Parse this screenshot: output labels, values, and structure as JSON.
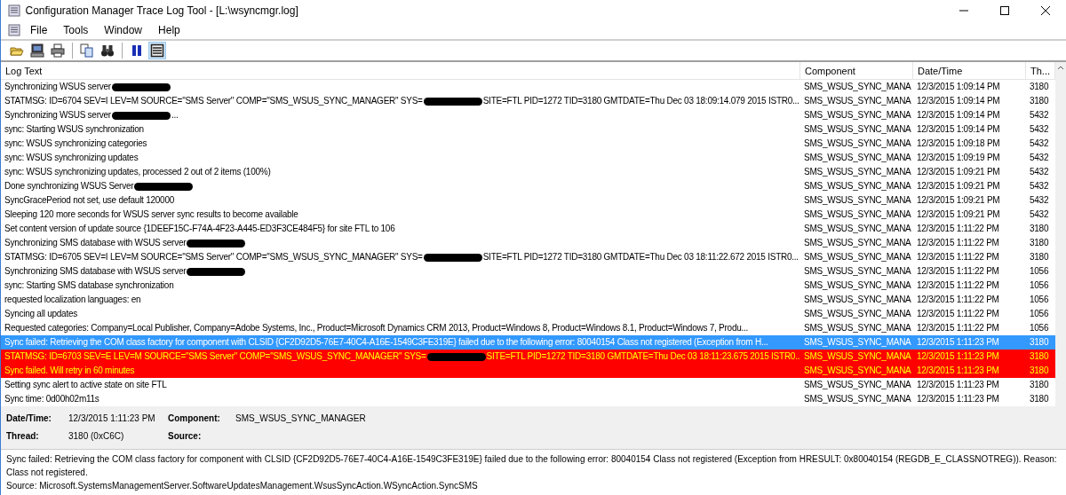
{
  "window": {
    "title": "Configuration Manager Trace Log Tool - [L:\\wsyncmgr.log]"
  },
  "menu": [
    "File",
    "Tools",
    "Window",
    "Help"
  ],
  "toolbar": [
    {
      "kind": "open",
      "pressed": false
    },
    {
      "kind": "computer",
      "pressed": false
    },
    {
      "kind": "print",
      "pressed": false
    },
    {
      "kind": "separator"
    },
    {
      "kind": "copy",
      "pressed": false
    },
    {
      "kind": "find",
      "pressed": false
    },
    {
      "kind": "separator"
    },
    {
      "kind": "pause",
      "pressed": false
    },
    {
      "kind": "highlight",
      "pressed": true
    }
  ],
  "table": {
    "columns": [
      "Log Text",
      "Component",
      "Date/Time",
      "Th..."
    ],
    "rows": [
      {
        "segments": [
          {
            "kind": "text",
            "text": "Synchronizing WSUS server"
          },
          {
            "kind": "redaction"
          }
        ],
        "component": "SMS_WSUS_SYNC_MANA",
        "datetime": "12/3/2015 1:09:14 PM",
        "thread": "3180",
        "selected": false,
        "error": false
      },
      {
        "segments": [
          {
            "kind": "text",
            "text": "STATMSG: ID=6704 SEV=I LEV=M SOURCE=\"SMS Server\" COMP=\"SMS_WSUS_SYNC_MANAGER\" SYS="
          },
          {
            "kind": "redaction"
          },
          {
            "kind": "text",
            "text": "SITE=FTL PID=1272 TID=3180 GMTDATE=Thu Dec 03 18:09:14.079 2015 ISTR0..."
          }
        ],
        "component": "SMS_WSUS_SYNC_MANA",
        "datetime": "12/3/2015 1:09:14 PM",
        "thread": "3180",
        "selected": false,
        "error": false
      },
      {
        "segments": [
          {
            "kind": "text",
            "text": "Synchronizing WSUS server"
          },
          {
            "kind": "redaction"
          },
          {
            "kind": "text",
            "text": "..."
          }
        ],
        "component": "SMS_WSUS_SYNC_MANA",
        "datetime": "12/3/2015 1:09:14 PM",
        "thread": "5432",
        "selected": false,
        "error": false
      },
      {
        "segments": [
          {
            "kind": "text",
            "text": "sync: Starting WSUS synchronization"
          }
        ],
        "component": "SMS_WSUS_SYNC_MANA",
        "datetime": "12/3/2015 1:09:14 PM",
        "thread": "5432",
        "selected": false,
        "error": false
      },
      {
        "segments": [
          {
            "kind": "text",
            "text": "sync: WSUS synchronizing categories"
          }
        ],
        "component": "SMS_WSUS_SYNC_MANA",
        "datetime": "12/3/2015 1:09:18 PM",
        "thread": "5432",
        "selected": false,
        "error": false
      },
      {
        "segments": [
          {
            "kind": "text",
            "text": "sync: WSUS synchronizing updates"
          }
        ],
        "component": "SMS_WSUS_SYNC_MANA",
        "datetime": "12/3/2015 1:09:19 PM",
        "thread": "5432",
        "selected": false,
        "error": false
      },
      {
        "segments": [
          {
            "kind": "text",
            "text": "sync: WSUS synchronizing updates, processed 2 out of 2 items (100%)"
          }
        ],
        "component": "SMS_WSUS_SYNC_MANA",
        "datetime": "12/3/2015 1:09:21 PM",
        "thread": "5432",
        "selected": false,
        "error": false
      },
      {
        "segments": [
          {
            "kind": "text",
            "text": "Done synchronizing WSUS Server"
          },
          {
            "kind": "redaction"
          }
        ],
        "component": "SMS_WSUS_SYNC_MANA",
        "datetime": "12/3/2015 1:09:21 PM",
        "thread": "5432",
        "selected": false,
        "error": false
      },
      {
        "segments": [
          {
            "kind": "text",
            "text": "SyncGracePeriod not set, use default 120000"
          }
        ],
        "component": "SMS_WSUS_SYNC_MANA",
        "datetime": "12/3/2015 1:09:21 PM",
        "thread": "5432",
        "selected": false,
        "error": false
      },
      {
        "segments": [
          {
            "kind": "text",
            "text": "Sleeping 120 more seconds for WSUS server sync results to become available"
          }
        ],
        "component": "SMS_WSUS_SYNC_MANA",
        "datetime": "12/3/2015 1:09:21 PM",
        "thread": "5432",
        "selected": false,
        "error": false
      },
      {
        "segments": [
          {
            "kind": "text",
            "text": "Set content version of update source {1DEEF15C-F74A-4F23-A445-ED3F3CE484F5} for site FTL to 106"
          }
        ],
        "component": "SMS_WSUS_SYNC_MANA",
        "datetime": "12/3/2015 1:11:22 PM",
        "thread": "3180",
        "selected": false,
        "error": false
      },
      {
        "segments": [
          {
            "kind": "text",
            "text": "Synchronizing SMS database with WSUS server"
          },
          {
            "kind": "redaction"
          }
        ],
        "component": "SMS_WSUS_SYNC_MANA",
        "datetime": "12/3/2015 1:11:22 PM",
        "thread": "3180",
        "selected": false,
        "error": false
      },
      {
        "segments": [
          {
            "kind": "text",
            "text": "STATMSG: ID=6705 SEV=I LEV=M SOURCE=\"SMS Server\" COMP=\"SMS_WSUS_SYNC_MANAGER\" SYS="
          },
          {
            "kind": "redaction"
          },
          {
            "kind": "text",
            "text": "SITE=FTL PID=1272 TID=3180 GMTDATE=Thu Dec 03 18:11:22.672 2015 ISTR0..."
          }
        ],
        "component": "SMS_WSUS_SYNC_MANA",
        "datetime": "12/3/2015 1:11:22 PM",
        "thread": "3180",
        "selected": false,
        "error": false
      },
      {
        "segments": [
          {
            "kind": "text",
            "text": "Synchronizing SMS database with WSUS server"
          },
          {
            "kind": "redaction"
          }
        ],
        "component": "SMS_WSUS_SYNC_MANA",
        "datetime": "12/3/2015 1:11:22 PM",
        "thread": "1056",
        "selected": false,
        "error": false
      },
      {
        "segments": [
          {
            "kind": "text",
            "text": "sync: Starting SMS database synchronization"
          }
        ],
        "component": "SMS_WSUS_SYNC_MANA",
        "datetime": "12/3/2015 1:11:22 PM",
        "thread": "1056",
        "selected": false,
        "error": false
      },
      {
        "segments": [
          {
            "kind": "text",
            "text": "requested localization languages: en"
          }
        ],
        "component": "SMS_WSUS_SYNC_MANA",
        "datetime": "12/3/2015 1:11:22 PM",
        "thread": "1056",
        "selected": false,
        "error": false
      },
      {
        "segments": [
          {
            "kind": "text",
            "text": "Syncing all updates"
          }
        ],
        "component": "SMS_WSUS_SYNC_MANA",
        "datetime": "12/3/2015 1:11:22 PM",
        "thread": "1056",
        "selected": false,
        "error": false
      },
      {
        "segments": [
          {
            "kind": "text",
            "text": "Requested categories: Company=Local Publisher, Company=Adobe Systems, Inc., Product=Microsoft Dynamics CRM 2013, Product=Windows 8, Product=Windows 8.1, Product=Windows 7, Produ..."
          }
        ],
        "component": "SMS_WSUS_SYNC_MANA",
        "datetime": "12/3/2015 1:11:22 PM",
        "thread": "1056",
        "selected": false,
        "error": false
      },
      {
        "segments": [
          {
            "kind": "text",
            "text": "Sync failed: Retrieving the COM class factory for component with CLSID {CF2D92D5-76E7-40C4-A16E-1549C3FE319E} failed due to the following error: 80040154 Class not registered (Exception from H..."
          }
        ],
        "component": "SMS_WSUS_SYNC_MANA",
        "datetime": "12/3/2015 1:11:23 PM",
        "thread": "3180",
        "selected": true,
        "error": false
      },
      {
        "segments": [
          {
            "kind": "text",
            "text": "STATMSG: ID=6703 SEV=E LEV=M SOURCE=\"SMS Server\" COMP=\"SMS_WSUS_SYNC_MANAGER\" SYS="
          },
          {
            "kind": "redaction"
          },
          {
            "kind": "text",
            "text": "SITE=FTL PID=1272 TID=3180 GMTDATE=Thu Dec 03 18:11:23.675 2015 ISTR0..."
          }
        ],
        "component": "SMS_WSUS_SYNC_MANA",
        "datetime": "12/3/2015 1:11:23 PM",
        "thread": "3180",
        "selected": false,
        "error": true
      },
      {
        "segments": [
          {
            "kind": "text",
            "text": "Sync failed. Will retry in 60 minutes"
          }
        ],
        "component": "SMS_WSUS_SYNC_MANA",
        "datetime": "12/3/2015 1:11:23 PM",
        "thread": "3180",
        "selected": false,
        "error": true
      },
      {
        "segments": [
          {
            "kind": "text",
            "text": "Setting sync alert to active state on site FTL"
          }
        ],
        "component": "SMS_WSUS_SYNC_MANA",
        "datetime": "12/3/2015 1:11:23 PM",
        "thread": "3180",
        "selected": false,
        "error": false
      },
      {
        "segments": [
          {
            "kind": "text",
            "text": "Sync time: 0d00h02m11s"
          }
        ],
        "component": "SMS_WSUS_SYNC_MANA",
        "datetime": "12/3/2015 1:11:23 PM",
        "thread": "3180",
        "selected": false,
        "error": false
      }
    ]
  },
  "details": {
    "fields": [
      {
        "label": "Date/Time:",
        "value": "12/3/2015 1:11:23 PM"
      },
      {
        "label": "Component:",
        "value": "SMS_WSUS_SYNC_MANAGER"
      },
      {
        "label": "Thread:",
        "value": "3180 (0xC6C)"
      },
      {
        "label": "Source:"
      }
    ],
    "message": [
      "Sync failed: Retrieving the COM class factory for component with CLSID {CF2D92D5-76E7-40C4-A16E-1549C3FE319E} failed due to the following error: 80040154 Class not registered (Exception from HRESULT: 0x80040154 (REGDB_E_CLASSNOTREG)). Reason: Class not registered.",
      "Source: Microsoft.SystemsManagementServer.SoftwareUpdatesManagement.WsusSyncAction.WSyncAction.SyncSMS"
    ]
  }
}
